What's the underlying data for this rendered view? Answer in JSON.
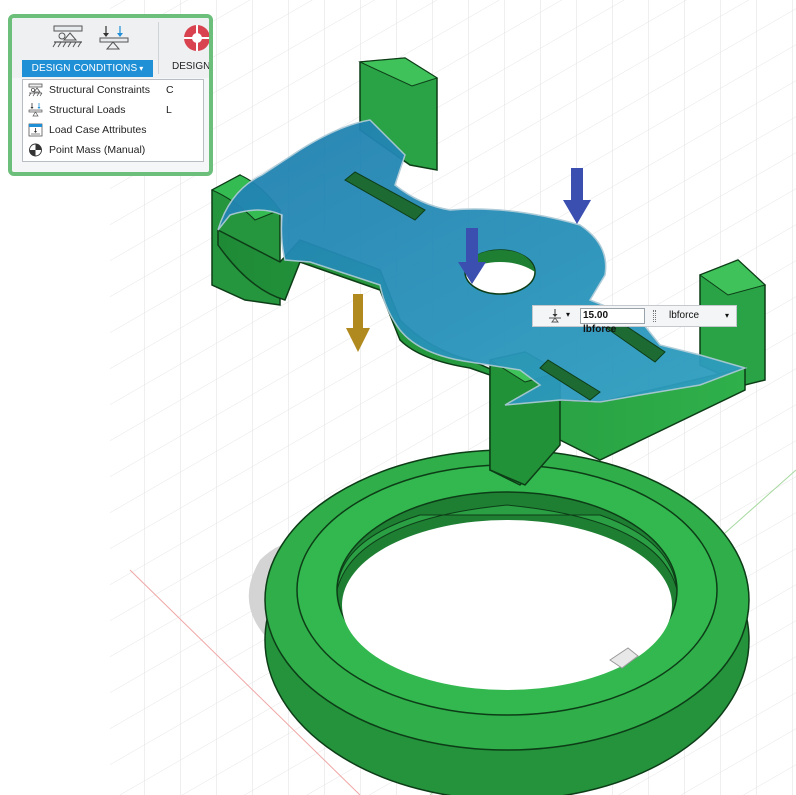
{
  "ribbon": {
    "design_conditions_label": "DESIGN CONDITIONS",
    "design_label": "DESIGN",
    "dropdown_caret": "▾"
  },
  "menu": {
    "items": [
      {
        "label": "Structural Constraints",
        "shortcut": "C",
        "icon": "structural-constraints-icon"
      },
      {
        "label": "Structural Loads",
        "shortcut": "L",
        "icon": "structural-loads-icon"
      },
      {
        "label": "Load Case Attributes",
        "shortcut": "",
        "icon": "load-case-attributes-icon"
      },
      {
        "label": "Point Mass (Manual)",
        "shortcut": "",
        "icon": "point-mass-icon"
      }
    ]
  },
  "load_input": {
    "value": "15.00 lbforce",
    "unit": "lbforce",
    "type_caret": "▾",
    "unit_caret": "▾"
  },
  "colors": {
    "model_green": "#2fa84a",
    "selected_face_blue": "#2a8fb0",
    "load_arrow_blue": "#3a4fb0",
    "gravity_arrow_gold": "#b08a1e",
    "toolbar_highlight": "#6cbf7a",
    "button_blue": "#1f8fd6"
  }
}
